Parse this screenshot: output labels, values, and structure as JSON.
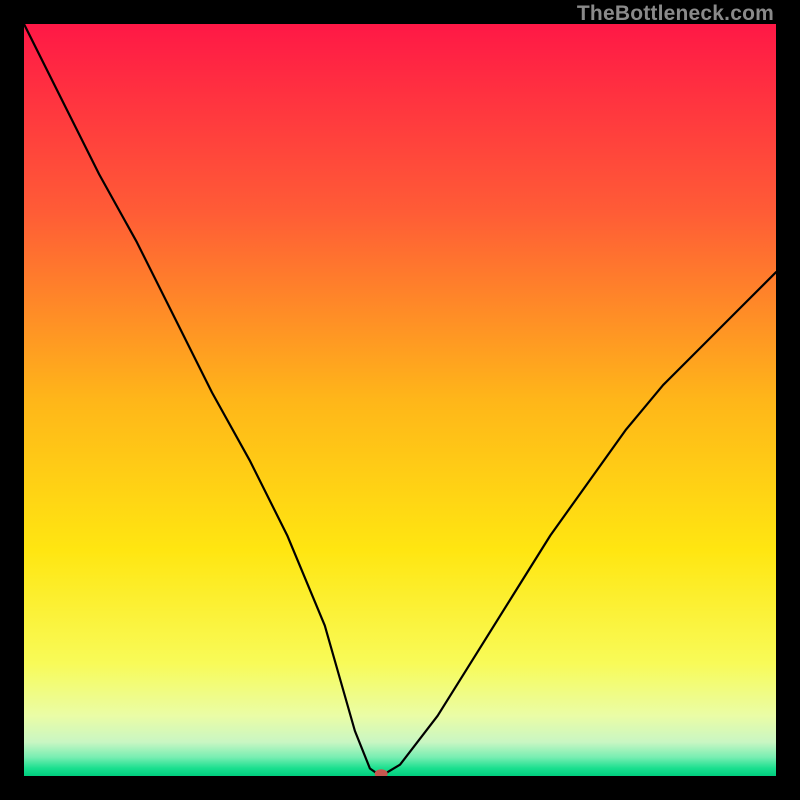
{
  "watermark": "TheBottleneck.com",
  "chart_data": {
    "type": "line",
    "title": "",
    "xlabel": "",
    "ylabel": "",
    "xlim": [
      0,
      100
    ],
    "ylim": [
      0,
      100
    ],
    "grid": false,
    "series": [
      {
        "name": "curve",
        "x": [
          0,
          5,
          10,
          15,
          20,
          25,
          30,
          35,
          40,
          42,
          44,
          46,
          47,
          48,
          50,
          55,
          60,
          65,
          70,
          75,
          80,
          85,
          90,
          95,
          100
        ],
        "y": [
          100,
          90,
          80,
          71,
          61,
          51,
          42,
          32,
          20,
          13,
          6,
          1,
          0.3,
          0.3,
          1.5,
          8,
          16,
          24,
          32,
          39,
          46,
          52,
          57,
          62,
          67
        ]
      }
    ],
    "marker": {
      "x": 47.5,
      "y": 0.3
    },
    "background_gradient": {
      "stops": [
        {
          "offset": 0.0,
          "color": "#ff1846"
        },
        {
          "offset": 0.25,
          "color": "#ff5c36"
        },
        {
          "offset": 0.5,
          "color": "#ffb619"
        },
        {
          "offset": 0.7,
          "color": "#ffe611"
        },
        {
          "offset": 0.85,
          "color": "#f8fb58"
        },
        {
          "offset": 0.92,
          "color": "#eafda6"
        },
        {
          "offset": 0.955,
          "color": "#c9f6c3"
        },
        {
          "offset": 0.975,
          "color": "#78eeb2"
        },
        {
          "offset": 0.99,
          "color": "#19df8e"
        },
        {
          "offset": 1.0,
          "color": "#00cd7e"
        }
      ]
    }
  }
}
